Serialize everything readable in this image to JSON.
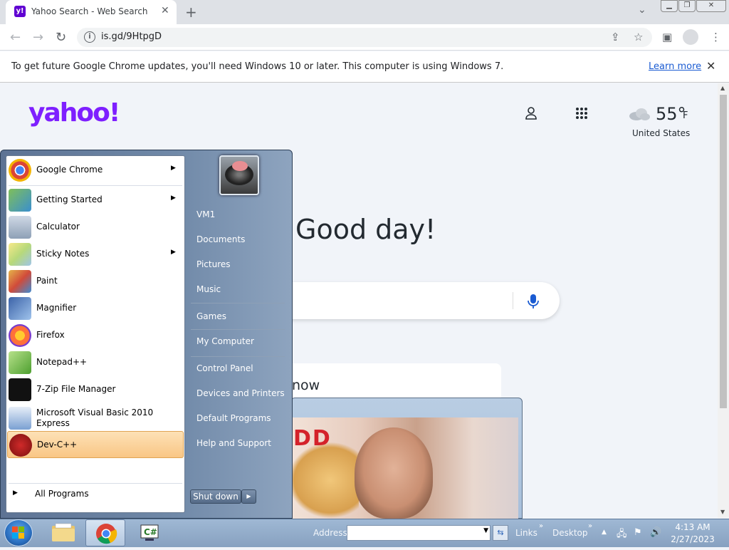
{
  "browser": {
    "tab_title": "Yahoo Search - Web Search",
    "tab_favicon": "y!",
    "url": "is.gd/9HtpgD",
    "infobar_message": "To get future Google Chrome updates, you'll need Windows 10 or later. This computer is using Windows 7.",
    "infobar_link": "Learn more"
  },
  "page": {
    "logo": "yahoo!",
    "temperature": "55°",
    "temperature_unit": "F",
    "country": "United States",
    "greeting": "Good day!",
    "card_text": "now",
    "popup_text": "DD"
  },
  "start_menu": {
    "programs": [
      {
        "label": "Google Chrome",
        "has_submenu": true,
        "icon": "chrome-icon"
      },
      {
        "label": "Getting Started",
        "has_submenu": true,
        "icon": "getting-started-icon"
      },
      {
        "label": "Calculator",
        "has_submenu": false,
        "icon": "calculator-icon"
      },
      {
        "label": "Sticky Notes",
        "has_submenu": true,
        "icon": "sticky-notes-icon"
      },
      {
        "label": "Paint",
        "has_submenu": false,
        "icon": "paint-icon"
      },
      {
        "label": "Magnifier",
        "has_submenu": false,
        "icon": "magnifier-icon"
      },
      {
        "label": "Firefox",
        "has_submenu": false,
        "icon": "firefox-icon"
      },
      {
        "label": "Notepad++",
        "has_submenu": false,
        "icon": "notepadpp-icon"
      },
      {
        "label": "7-Zip File Manager",
        "has_submenu": false,
        "icon": "7zip-icon"
      },
      {
        "label": "Microsoft Visual Basic 2010",
        "label2": "Express",
        "has_submenu": false,
        "icon": "visual-basic-icon"
      },
      {
        "label": "Dev-C++",
        "has_submenu": false,
        "icon": "devcpp-icon",
        "highlighted": true
      }
    ],
    "all_programs": "All Programs",
    "right_items": [
      "VM1",
      "Documents",
      "Pictures",
      "Music",
      "Games",
      "My Computer",
      "Control Panel",
      "Devices and Printers",
      "Default Programs",
      "Help and Support"
    ],
    "shutdown": "Shut down"
  },
  "taskbar": {
    "address_label": "Address",
    "address_value": "",
    "links_label": "Links",
    "desktop_label": "Desktop",
    "time": "4:13 AM",
    "date": "2/27/2023"
  },
  "colors": {
    "yahoo_purple": "#7e1fff",
    "start_highlight": "#f9c685",
    "taskbar": "#8fa8c6"
  }
}
